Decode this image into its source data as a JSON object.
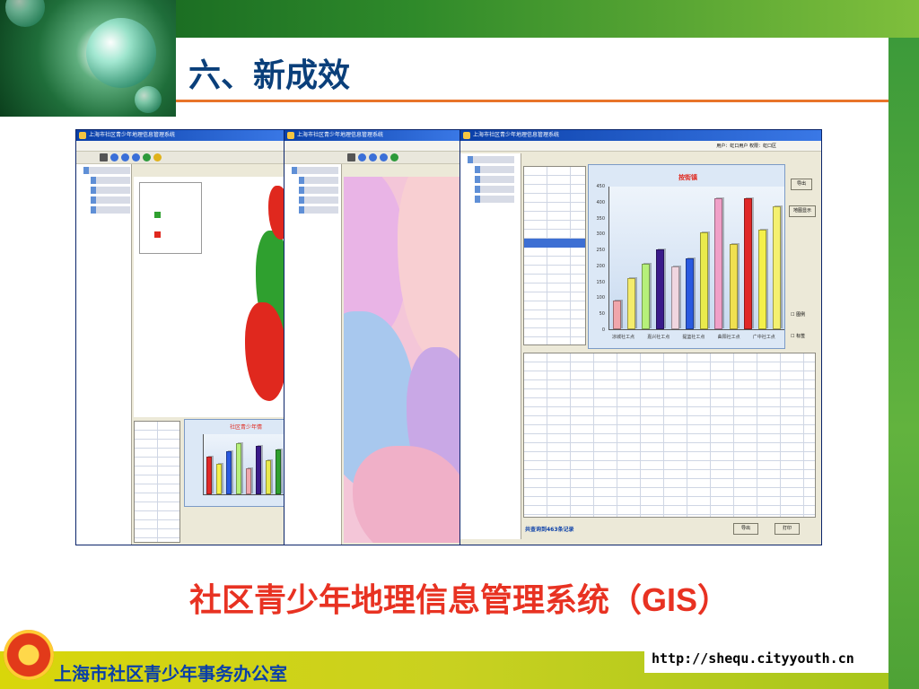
{
  "slide": {
    "title": "六、新成效",
    "caption_cn": "社区青少年地理信息管理系统（",
    "caption_latin": "GIS",
    "caption_close": "）",
    "organization": "上海市社区青少年事务办公室",
    "url": "http://shequ.cityyouth.cn"
  },
  "colors": {
    "title": "#0a3f7a",
    "caption": "#e83222",
    "accent_line": "#e8742a",
    "brand_green": "#3c9a3a",
    "bottom_bar": "#d9d60a",
    "organization": "#0a3fa8"
  },
  "windows": [
    {
      "id": "win1",
      "title": "上海市社区青少年地理信息管理系统",
      "menu": [
        "",
        "",
        "",
        "",
        "",
        ""
      ],
      "map_colors": [
        "#2fa02f",
        "#e0281e"
      ]
    },
    {
      "id": "win2",
      "title": "上海市社区青少年地理信息管理系统",
      "menu": [
        "",
        "",
        "",
        "",
        "",
        ""
      ],
      "map_colors": [
        "#f4c6d8",
        "#a8c8ee",
        "#c9a8e6",
        "#f0b0c8"
      ]
    },
    {
      "id": "win3",
      "title": "上海市社区青少年地理信息管理系统",
      "menu": [
        "",
        "",
        "",
        "",
        "",
        ""
      ],
      "user_bar": "用户：虹口用户 权限：虹口区"
    }
  ],
  "chart_data": [
    {
      "type": "bar",
      "title": "按街镇",
      "categories": [
        "凉城社工点",
        "嘉兴社工点",
        "提篮社工点",
        "曲阳社工点",
        "广中社工点"
      ],
      "values": [
        100,
        180,
        230,
        280,
        220,
        250,
        340,
        460,
        300,
        460,
        350,
        430
      ],
      "colors": [
        "#f0a6ac",
        "#f4ec6c",
        "#b6f07a",
        "#3a1a8a",
        "#f0d6e0",
        "#2a5ae0",
        "#e9ea4c",
        "#f0a0c8",
        "#f0e050",
        "#e02828",
        "#f4f04a",
        "#f4f070"
      ],
      "ylim": [
        0,
        500
      ],
      "yticks": [
        "450",
        "400",
        "350",
        "300",
        "250",
        "200",
        "150",
        "100",
        "50",
        "0"
      ],
      "buttons": {
        "export": "导出",
        "map_view": "地图显示",
        "print": "打印",
        "export2": "导出",
        "print2": "打印"
      },
      "checkboxes": [
        "图例",
        "标签"
      ],
      "footer": "共查询到463条记录"
    },
    {
      "type": "bar",
      "title": "社区青少年情",
      "values": [
        220,
        180,
        250,
        300,
        150,
        280,
        200,
        260
      ],
      "colors": [
        "#e02828",
        "#f4f04a",
        "#2a5ae0",
        "#b6f07a",
        "#f0a6ac",
        "#3a1a8a",
        "#e9ea4c",
        "#2fa02f"
      ],
      "ylim": [
        0,
        350
      ]
    }
  ]
}
